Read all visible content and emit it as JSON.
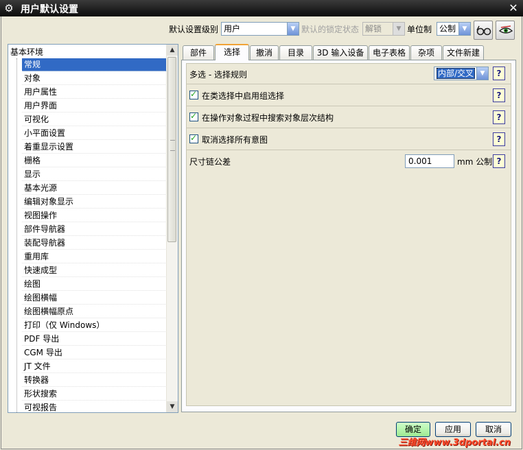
{
  "window": {
    "title": "用户默认设置"
  },
  "toolbar": {
    "level_label": "默认设置级别",
    "level_value": "用户",
    "lock_label": "默认的锁定状态",
    "lock_value": "解锁",
    "unit_label": "单位制",
    "unit_value": "公制"
  },
  "tree": {
    "root": "基本环境",
    "items": [
      "常规",
      "对象",
      "用户属性",
      "用户界面",
      "可视化",
      "小平面设置",
      "着重显示设置",
      "栅格",
      "显示",
      "基本光源",
      "编辑对象显示",
      "视图操作",
      "部件导航器",
      "装配导航器",
      "重用库",
      "快速成型",
      "绘图",
      "绘图横幅",
      "绘图横幅原点",
      "打印（仅 Windows）",
      "PDF 导出",
      "CGM 导出",
      "JT 文件",
      "转换器",
      "形状搜索",
      "可视报告"
    ],
    "selected_index": 0
  },
  "tabs": [
    "部件",
    "选择",
    "撤消",
    "目录",
    "3D 输入设备",
    "电子表格",
    "杂项",
    "文件新建"
  ],
  "active_tab": 1,
  "settings": {
    "multi_select_label": "多选 - 选择规则",
    "multi_select_value": "内部/交叉",
    "group_select_label": "在类选择中启用组选择",
    "hierarchy_search_label": "在操作对象过程中搜索对象层次结构",
    "cancel_intent_label": "取消选择所有意图",
    "tolerance_label": "尺寸链公差",
    "tolerance_value": "0.001",
    "tolerance_unit": "mm 公制",
    "help_symbol": "?"
  },
  "buttons": {
    "ok": "确定",
    "apply": "应用",
    "cancel": "取消"
  },
  "watermark": "三维网www.3dportal.cn"
}
